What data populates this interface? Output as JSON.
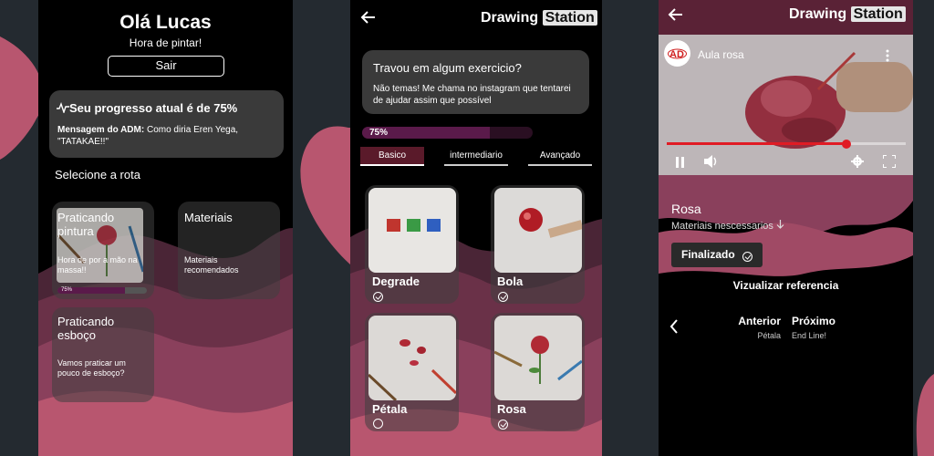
{
  "colors": {
    "accent": "#b8566f",
    "wave_dark": "#4a2536",
    "wave_mid": "#7a3a52",
    "progress": "#5a1a4a",
    "red_bar": "#e01b24"
  },
  "screen1": {
    "greeting": "Olá Lucas",
    "subtitle": "Hora de pintar!",
    "logout_label": "Sair",
    "progress_text": "Seu progresso atual é de 75%",
    "admin_label": "Mensagem do ADM:",
    "admin_message": " Como diria Eren Yega, \"TATAKAE!!\"",
    "select_route": "Selecione a rota",
    "cards": [
      {
        "title": "Praticando pintura",
        "desc": "Hora de por a mão na massa!!",
        "progress_label": "75%",
        "progress": 0.75
      },
      {
        "title": "Materiais",
        "desc": "Materiais recomendados"
      },
      {
        "title": "Praticando esboço",
        "desc": "Vamos praticar um pouco de esboço?"
      }
    ]
  },
  "screen2": {
    "logo_drawing": "Drawing",
    "logo_station": "Station",
    "help_title": "Travou em algum exercicio?",
    "help_text": "Não temas! Me chama no instagram que tentarei de ajudar assim que possível",
    "progress_label": "75%",
    "progress": 0.75,
    "tabs": [
      "Basico",
      "intermediario",
      "Avançado"
    ],
    "lessons": [
      {
        "name": "Degrade",
        "done": true
      },
      {
        "name": "Bola",
        "done": true
      },
      {
        "name": "Pétala",
        "done": false
      },
      {
        "name": "Rosa",
        "done": true
      }
    ]
  },
  "screen3": {
    "logo_drawing": "Drawing",
    "logo_station": "Station",
    "video_title": "Aula rosa",
    "video_progress": 0.75,
    "lesson_title": "Rosa",
    "materials_label": "Materiais nescessarios",
    "finished_label": "Finalizado",
    "view_reference": "Vizualizar referencia",
    "prev_label": "Anterior",
    "prev_name": "Pétala",
    "next_label": "Próximo",
    "next_name": "End Line!"
  }
}
